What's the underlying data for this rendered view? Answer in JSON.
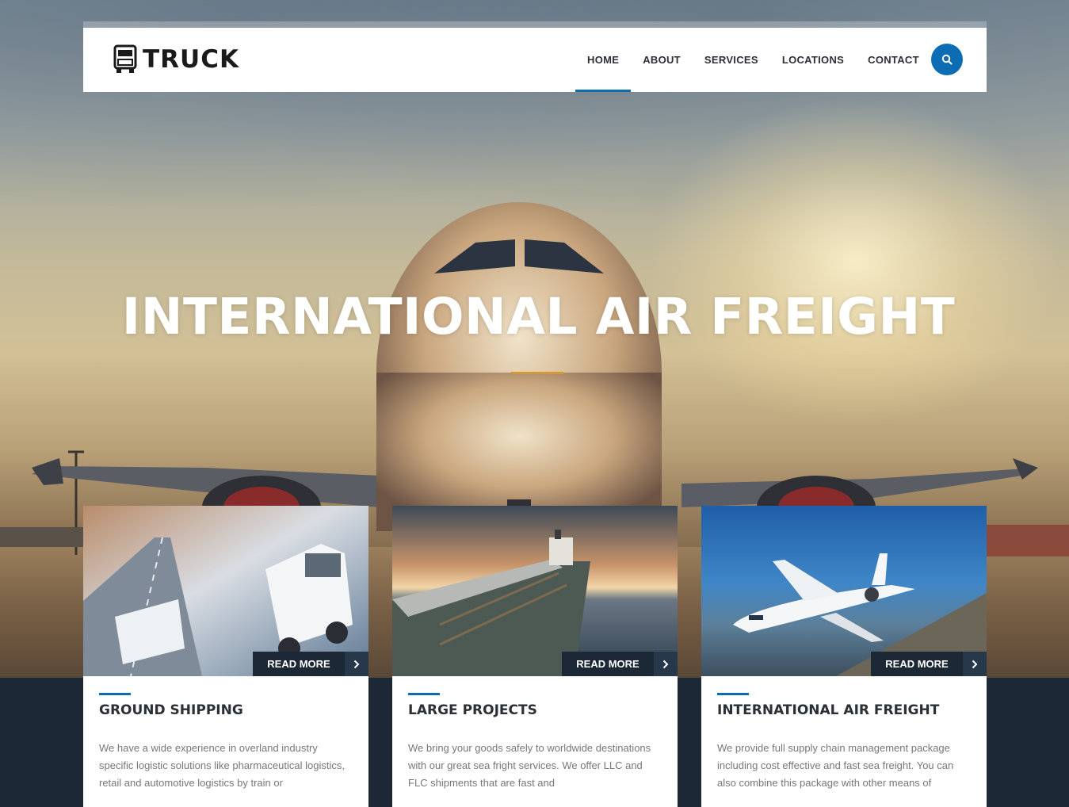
{
  "header": {
    "logo_text": "TRUCK",
    "nav": [
      {
        "label": "HOME",
        "active": true
      },
      {
        "label": "ABOUT",
        "active": false
      },
      {
        "label": "SERVICES",
        "active": false
      },
      {
        "label": "LOCATIONS",
        "active": false
      },
      {
        "label": "CONTACT",
        "active": false
      }
    ],
    "search_icon": "search-icon"
  },
  "hero": {
    "title": "INTERNATIONAL AIR FREIGHT",
    "accent_color": "#d29a36"
  },
  "cards": [
    {
      "title": "GROUND SHIPPING",
      "button_label": "READ MORE",
      "text": "We have a wide experience in overland industry specific logistic solutions like pharmaceutical logistics, retail and automotive logistics by train or"
    },
    {
      "title": "LARGE PROJECTS",
      "button_label": "READ MORE",
      "text": "We bring your goods safely to worldwide destinations with our great sea fright services. We offer LLC and FLC shipments that are fast and"
    },
    {
      "title": "INTERNATIONAL AIR FREIGHT",
      "button_label": "READ MORE",
      "text": "We provide full supply chain management package including cost effective and fast sea freight. You can also combine this package with other means of"
    }
  ],
  "colors": {
    "brand_blue": "#0c6cb4",
    "dark_navy": "#1c2836",
    "text_dark": "#2b2f36",
    "text_muted": "#777777"
  }
}
